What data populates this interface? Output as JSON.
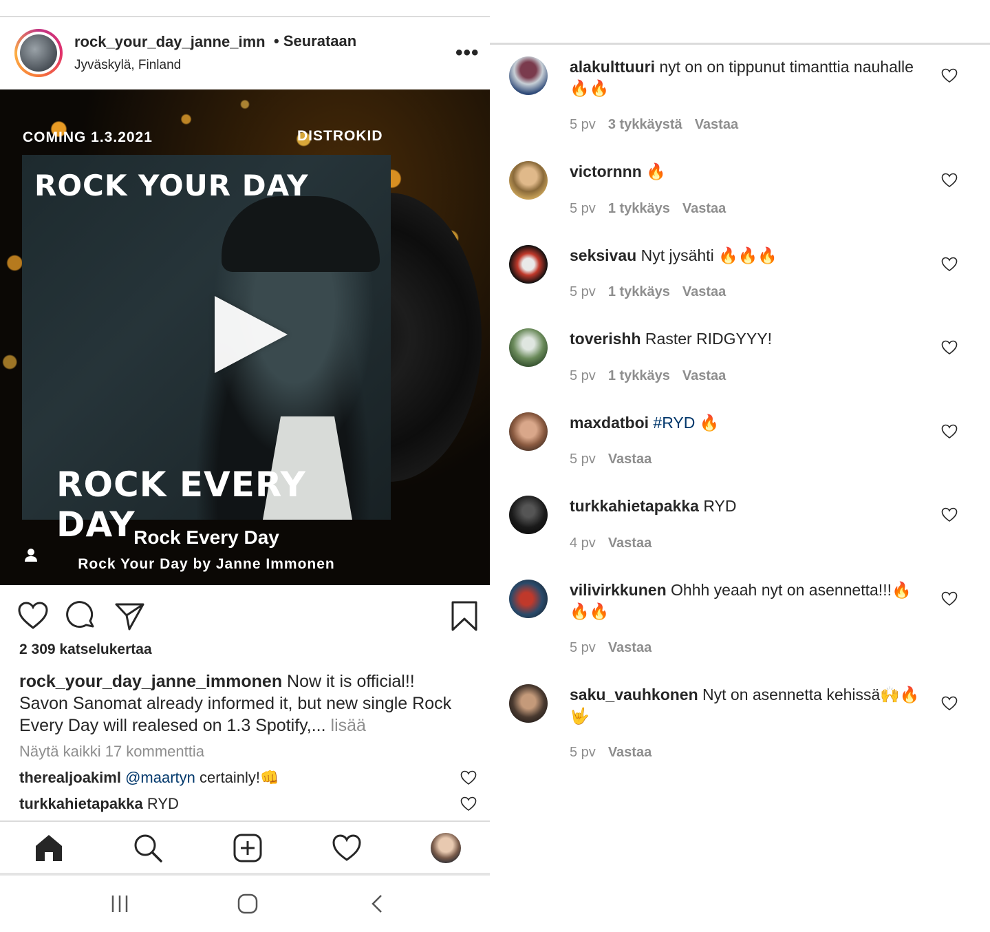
{
  "post": {
    "username": "rock_your_day_janne_imn",
    "follow_status": "• Seurataan",
    "location": "Jyväskylä, Finland",
    "more_icon": "more-icon"
  },
  "media": {
    "coming": "COMING 1.3.2021",
    "distributor": "DISTROKID",
    "cover_title": "ROCK YOUR DAY",
    "cover_subtitle": "ROCK EVERY DAY",
    "song_title": "Rock Every Day",
    "song_artist": "Rock Your Day by Janne Immonen"
  },
  "stats": {
    "views": "2 309 katselukertaa"
  },
  "caption": {
    "author": "rock_your_day_janne_immonen",
    "text": " Now it is official!! Savon Sanomat already informed it, but new single Rock Every Day will realesed on 1.3 Spotify,... ",
    "more": "lisää"
  },
  "view_all": "Näytä kaikki 17 kommenttia",
  "preview_comments": [
    {
      "user": "therealjoakiml",
      "mention": "@maartyn",
      "text": " certainly!👊"
    },
    {
      "user": "turkkahietapakka",
      "mention": "",
      "text": " RYD"
    }
  ],
  "comments": [
    {
      "user": "alakulttuuri",
      "text": " nyt on on tippunut timanttia nauhalle🔥🔥",
      "hashtag": "",
      "time": "5 pv",
      "likes": "3 tykkäystä",
      "reply": "Vastaa"
    },
    {
      "user": "victornnn",
      "text": " 🔥",
      "hashtag": "",
      "time": "5 pv",
      "likes": "1 tykkäys",
      "reply": "Vastaa"
    },
    {
      "user": "seksivau",
      "text": " Nyt jysähti 🔥🔥🔥",
      "hashtag": "",
      "time": "5 pv",
      "likes": "1 tykkäys",
      "reply": "Vastaa"
    },
    {
      "user": "toverishh",
      "text": " Raster RIDGYYY!",
      "hashtag": "",
      "time": "5 pv",
      "likes": "1 tykkäys",
      "reply": "Vastaa"
    },
    {
      "user": "maxdatboi",
      "text": " 🔥",
      "hashtag": " #RYD",
      "time": "5 pv",
      "likes": "",
      "reply": "Vastaa"
    },
    {
      "user": "turkkahietapakka",
      "text": " RYD",
      "hashtag": "",
      "time": "4 pv",
      "likes": "",
      "reply": "Vastaa"
    },
    {
      "user": "vilivirkkunen",
      "text": " Ohhh yeaah nyt on asennetta!!!🔥🔥🔥",
      "hashtag": "",
      "time": "5 pv",
      "likes": "",
      "reply": "Vastaa"
    },
    {
      "user": "saku_vauhkonen",
      "text": " Nyt on asennetta kehissä🙌🔥🤟",
      "hashtag": "",
      "time": "5 pv",
      "likes": "",
      "reply": "Vastaa"
    }
  ],
  "colors": {
    "link": "#00376b",
    "muted": "#8e8e8e",
    "text": "#262626"
  }
}
